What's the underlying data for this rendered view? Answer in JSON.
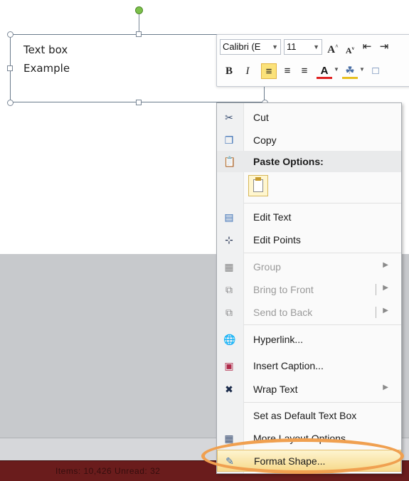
{
  "textbox": {
    "line1": "Text box",
    "line2": "Example"
  },
  "mini_toolbar": {
    "font": "Calibri (E",
    "size": "11",
    "grow_font": "A",
    "shrink_font": "A",
    "bold": "B",
    "italic": "I",
    "font_color": "A"
  },
  "context_menu": {
    "cut": "Cut",
    "copy": "Copy",
    "paste_options": "Paste Options:",
    "edit_text": "Edit Text",
    "edit_points": "Edit Points",
    "group": "Group",
    "bring_to_front": "Bring to Front",
    "send_to_back": "Send to Back",
    "hyperlink": "Hyperlink...",
    "insert_caption": "Insert Caption...",
    "wrap_text": "Wrap Text",
    "set_default": "Set as Default Text Box",
    "more_layout": "More Layout Options...",
    "format_shape": "Format Shape..."
  },
  "status_bar": {
    "text": "Items: 10,426   Unread: 32"
  },
  "colors": {
    "highlight_ring": "#f0a050",
    "active_button": "#fbe27a"
  }
}
